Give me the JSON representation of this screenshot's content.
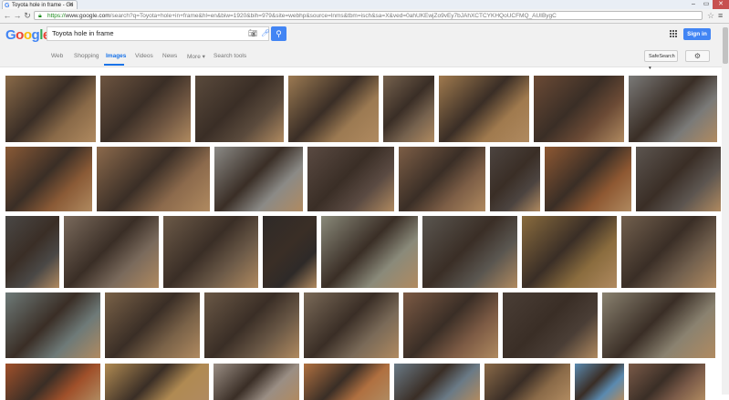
{
  "browser": {
    "tab_title": "Toyota hole in frame - Go",
    "url_scheme": "https://",
    "url_host": "www.google.com",
    "url_path": "/search?q=Toyota+hole+in+frame&hl=en&biw=1920&bih=979&site=webhp&source=lnms&tbm=isch&sa=X&ved=0ahUKEwjZo9vEy7bJAhXCTCYKHQoUCFMQ_AUIBygC"
  },
  "header": {
    "query": "Toyota hole in frame",
    "signin_label": "Sign in"
  },
  "nav": {
    "tabs": [
      {
        "label": "Web"
      },
      {
        "label": "Shopping"
      },
      {
        "label": "Images"
      },
      {
        "label": "Videos"
      },
      {
        "label": "News"
      },
      {
        "label": "More ▾"
      },
      {
        "label": "Search tools"
      }
    ],
    "safesearch_label": "SafeSearch ▾"
  },
  "results": {
    "rows": [
      [
        {
          "c": "#8a6a48"
        },
        {
          "c": "#6d5440"
        },
        {
          "c": "#5a4a3c"
        },
        {
          "c": "#9c7a52"
        },
        {
          "c": "#76624e"
        },
        {
          "c": "#a07a4e"
        },
        {
          "c": "#6b4a35"
        },
        {
          "c": "#7a7a78"
        }
      ],
      [
        {
          "c": "#8a5a36"
        },
        {
          "c": "#8c6a4c"
        },
        {
          "c": "#8b8a86"
        },
        {
          "c": "#5a4a42"
        },
        {
          "c": "#7d5e46"
        },
        {
          "c": "#4c4440"
        },
        {
          "c": "#8e5832"
        },
        {
          "c": "#5c5550"
        }
      ],
      [
        {
          "c": "#4a4846"
        },
        {
          "c": "#7a6a5c"
        },
        {
          "c": "#6c5a48"
        },
        {
          "c": "#2e2a28"
        },
        {
          "c": "#8a8a7a"
        },
        {
          "c": "#5a5650"
        },
        {
          "c": "#8a6c3e"
        },
        {
          "c": "#72604e"
        }
      ],
      [
        {
          "c": "#6e7a78"
        },
        {
          "c": "#7a6248"
        },
        {
          "c": "#6a5846"
        },
        {
          "c": "#7a6a58"
        },
        {
          "c": "#7c5a44"
        },
        {
          "c": "#4a3e36"
        },
        {
          "c": "#8a8270"
        }
      ],
      [
        {
          "c": "#a0502a"
        },
        {
          "c": "#b08a52"
        },
        {
          "c": "#9a8e84"
        },
        {
          "c": "#b07040"
        },
        {
          "c": "#6a7a86"
        },
        {
          "c": "#8a6a48"
        },
        {
          "c": "#5a8ab0"
        },
        {
          "c": "#7a5a48"
        }
      ]
    ]
  }
}
